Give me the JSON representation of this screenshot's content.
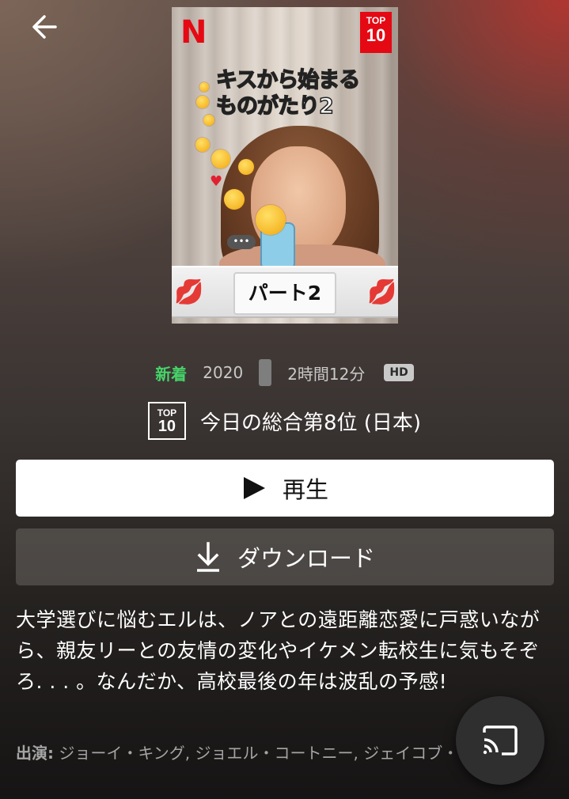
{
  "nav": {
    "back_icon": "arrow-left-icon"
  },
  "poster": {
    "brand_letter": "N",
    "top_badge_line1": "TOP",
    "top_badge_line2": "10",
    "title": "キスから始まる\nものがたり2",
    "part_label": "パート2",
    "typing_dots": "•••"
  },
  "meta": {
    "new_label": "新着",
    "year": "2020",
    "duration": "2時間12分",
    "quality": "HD"
  },
  "rank": {
    "badge_line1": "TOP",
    "badge_line2": "10",
    "text": "今日の総合第8位 (日本)"
  },
  "actions": {
    "play_label": "再生",
    "download_label": "ダウンロード"
  },
  "synopsis": "大学選びに悩むエルは、ノアとの遠距離恋愛に戸惑いながら、親友リーとの友情の変化やイケメン転校生に気もそぞろ. . . 。なんだか、高校最後の年は波乱の予感!",
  "cast": {
    "label": "出演:",
    "names": "ジョーイ・キング, ジョエル・コートニー, ジェイコブ・エロルディ"
  },
  "colors": {
    "netflix_red": "#e50914",
    "new_green": "#46d369",
    "play_bg": "#ffffff"
  }
}
